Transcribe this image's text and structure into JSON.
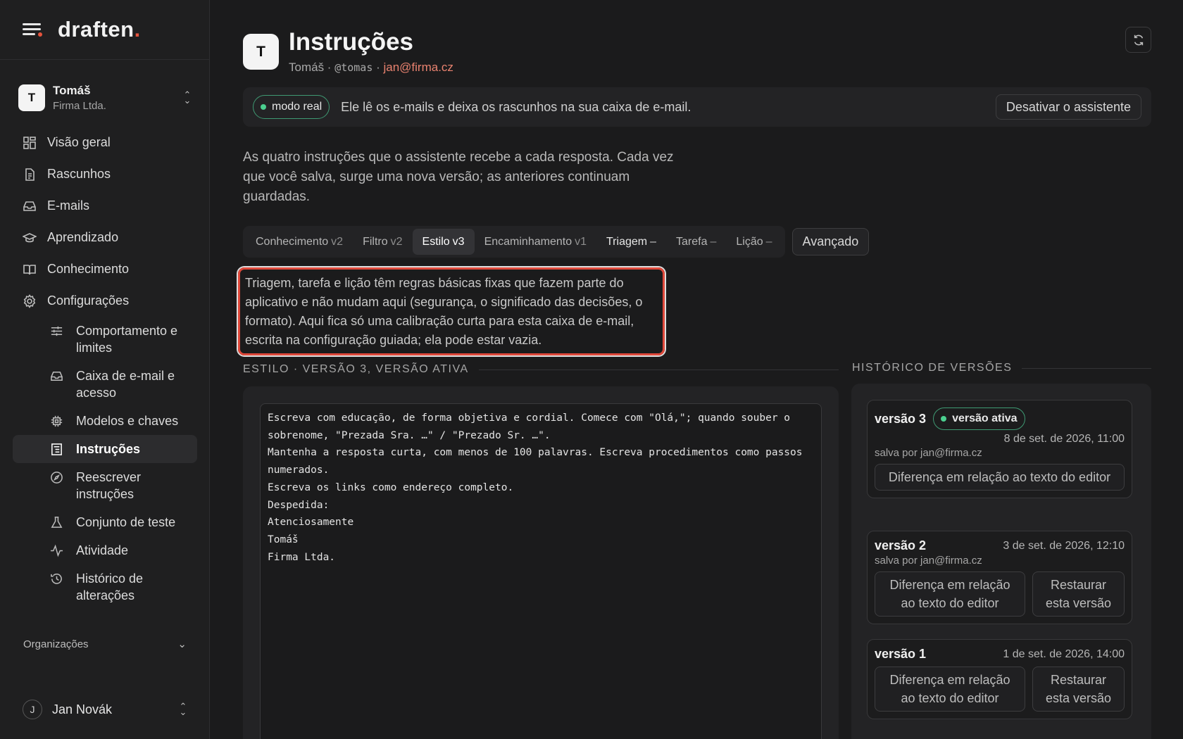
{
  "brand": {
    "name": "draften",
    "dot": "."
  },
  "account": {
    "initial": "T",
    "name": "Tomáš",
    "org": "Firma Ltda."
  },
  "nav": {
    "items": [
      {
        "label": "Visão geral",
        "icon": "grid-icon"
      },
      {
        "label": "Rascunhos",
        "icon": "document-icon"
      },
      {
        "label": "E-mails",
        "icon": "inbox-icon"
      },
      {
        "label": "Aprendizado",
        "icon": "graduation-cap-icon"
      },
      {
        "label": "Conhecimento",
        "icon": "book-icon"
      },
      {
        "label": "Configurações",
        "icon": "gear-icon"
      }
    ],
    "sub": [
      {
        "label": "Comportamento e limites",
        "icon": "sliders-icon"
      },
      {
        "label": "Caixa de e-mail e acesso",
        "icon": "inbox-icon"
      },
      {
        "label": "Modelos e chaves",
        "icon": "chip-icon"
      },
      {
        "label": "Instruções",
        "icon": "instructions-icon",
        "active": true
      },
      {
        "label": "Reescrever instruções",
        "icon": "compass-icon"
      },
      {
        "label": "Conjunto de teste",
        "icon": "flask-icon"
      },
      {
        "label": "Atividade",
        "icon": "activity-icon"
      },
      {
        "label": "Histórico de alterações",
        "icon": "history-icon"
      }
    ],
    "organizations": "Organizações"
  },
  "user": {
    "initial": "J",
    "name": "Jan Novák"
  },
  "header": {
    "initial": "T",
    "title": "Instruções",
    "name": "Tomáš",
    "sep1": " · ",
    "handle": "@tomas",
    "sep2": " · ",
    "email": "jan@firma.cz"
  },
  "mode": {
    "badge": "modo real",
    "description": "Ele lê os e-mails e deixa os rascunhos na sua caixa de e-mail.",
    "deactivate": "Desativar o assistente"
  },
  "intro": "As quatro instruções que o assistente recebe a cada resposta. Cada vez que você salva, surge uma nova versão; as anteriores continuam guardadas.",
  "tabs": [
    {
      "label": "Conhecimento",
      "version": "v2"
    },
    {
      "label": "Filtro",
      "version": "v2"
    },
    {
      "label": "Estilo",
      "version": "v3"
    },
    {
      "label": "Encaminhamento",
      "version": "v1"
    },
    {
      "label": "Triagem",
      "version": "–"
    },
    {
      "label": "Tarefa",
      "version": "–"
    },
    {
      "label": "Lição",
      "version": "–"
    }
  ],
  "advanced": "Avançado",
  "note": "Triagem, tarefa e lição têm regras básicas fixas que fazem parte do aplicativo e não mudam aqui (segurança, o significado das decisões, o formato). Aqui fica só uma calibração curta para esta caixa de e-mail, escrita na configuração guiada; ela pode estar vazia.",
  "editor": {
    "section_title": "ESTILO · VERSÃO 3, VERSÃO ATIVA",
    "content": "Escreva com educação, de forma objetiva e cordial. Comece com \"Olá,\"; quando souber o sobrenome, \"Prezada Sra. …\" / \"Prezado Sr. …\".\nMantenha a resposta curta, com menos de 100 palavras. Escreva procedimentos como passos numerados.\nEscreva os links como endereço completo.\nDespedida:\nAtenciosamente\nTomáš\nFirma Ltda."
  },
  "history": {
    "section_title": "HISTÓRICO DE VERSÕES",
    "versions": [
      {
        "name": "versão 3",
        "badge": "versão ativa",
        "date": "8 de set. de 2026, 11:00",
        "saved_by": "salva por jan@firma.cz",
        "diff": "Diferença em relação ao texto do editor"
      },
      {
        "name": "versão 2",
        "date": "3 de set. de 2026, 12:10",
        "saved_by": "salva por jan@firma.cz",
        "diff": "Diferença em relação ao texto do editor",
        "restore": "Restaurar esta versão"
      },
      {
        "name": "versão 1",
        "date": "1 de set. de 2026, 14:00",
        "diff": "Diferença em relação ao texto do editor",
        "restore": "Restaurar esta versão"
      }
    ]
  }
}
